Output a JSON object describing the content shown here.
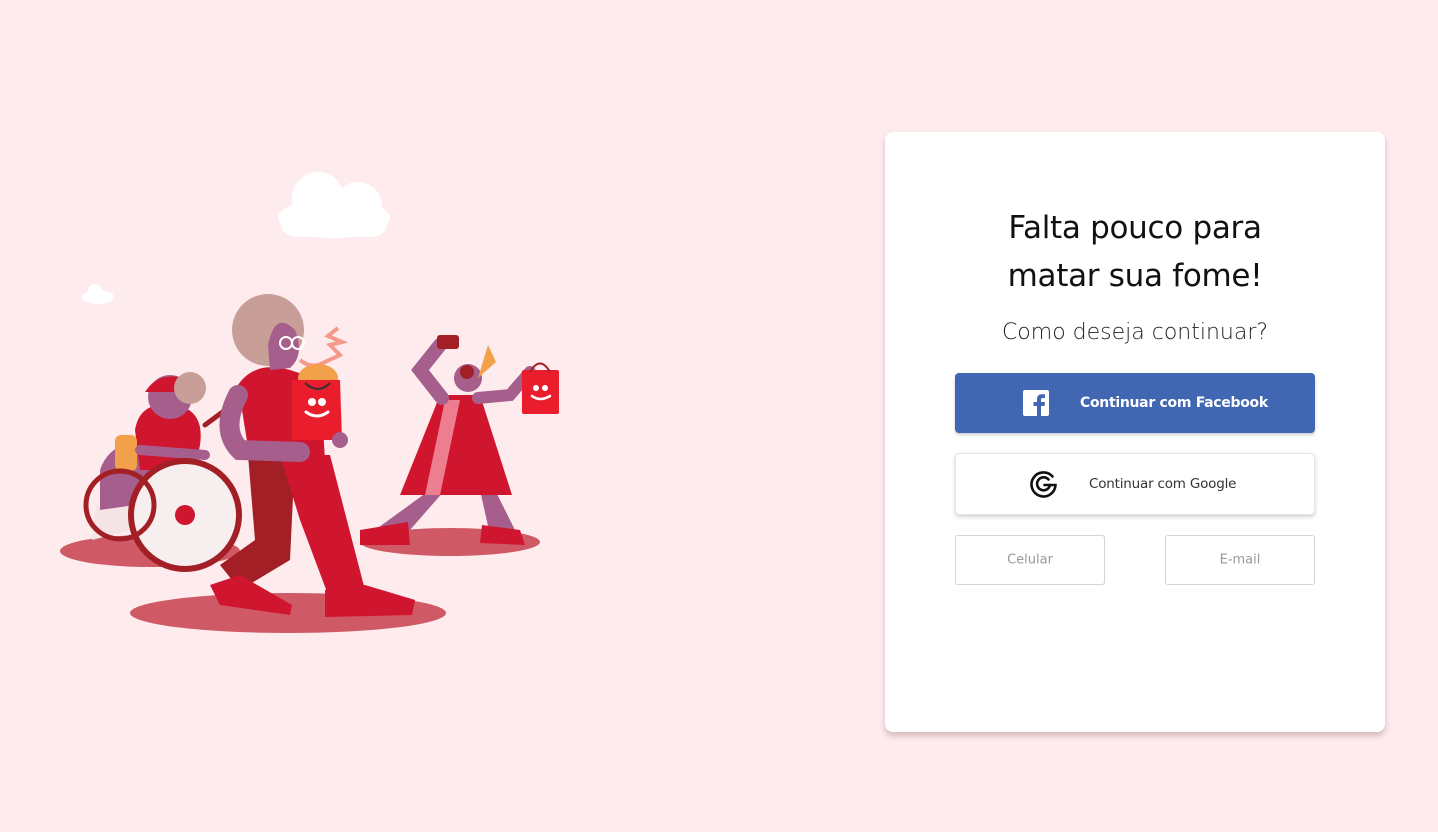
{
  "illustration": {
    "description_name": "people-shopping-illustration"
  },
  "login_card": {
    "title_line1": "Falta pouco para",
    "title_line2": "matar sua fome!",
    "subtitle": "Como deseja continuar?",
    "facebook_button": {
      "label": "Continuar com Facebook",
      "icon": "facebook-icon",
      "color": "#4267b2"
    },
    "google_button": {
      "label": "Continuar com Google",
      "icon": "google-icon"
    },
    "phone_button": {
      "label": "Celular"
    },
    "email_button": {
      "label": "E-mail"
    }
  },
  "colors": {
    "background": "#fdebee",
    "brand_red": "#ea1d2c",
    "card": "#ffffff"
  }
}
